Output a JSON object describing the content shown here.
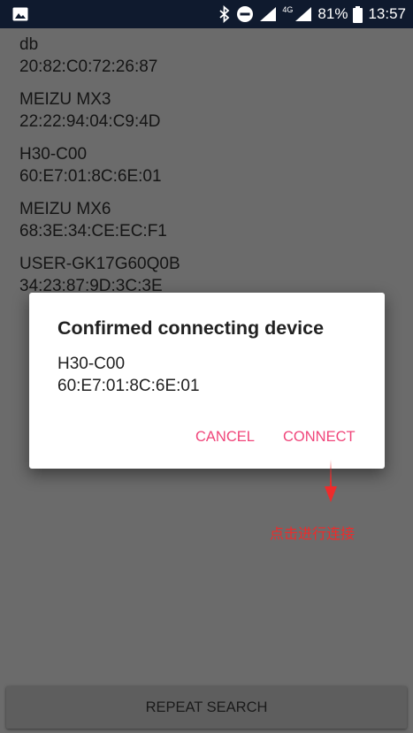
{
  "status_bar": {
    "network_type": "4G",
    "battery_percent": "81%",
    "time": "13:57"
  },
  "devices": [
    {
      "name": "db",
      "address": "20:82:C0:72:26:87"
    },
    {
      "name": "MEIZU MX3",
      "address": "22:22:94:04:C9:4D"
    },
    {
      "name": "H30-C00",
      "address": "60:E7:01:8C:6E:01"
    },
    {
      "name": "MEIZU MX6",
      "address": "68:3E:34:CE:EC:F1"
    },
    {
      "name": "USER-GK17G60Q0B",
      "address": "34:23:87:9D:3C:3E"
    }
  ],
  "dialog": {
    "title": "Confirmed connecting device",
    "device_name": "H30-C00",
    "device_address": "60:E7:01:8C:6E:01",
    "cancel_label": "CANCEL",
    "connect_label": "CONNECT"
  },
  "annotation": {
    "text": "点击进行连接"
  },
  "repeat_search_label": "REPEAT SEARCH",
  "colors": {
    "accent": "#f0457a",
    "annotation": "#ee2b2b",
    "status_bar": "#0f1a2e",
    "scrim_background": "#6b6b6b"
  }
}
